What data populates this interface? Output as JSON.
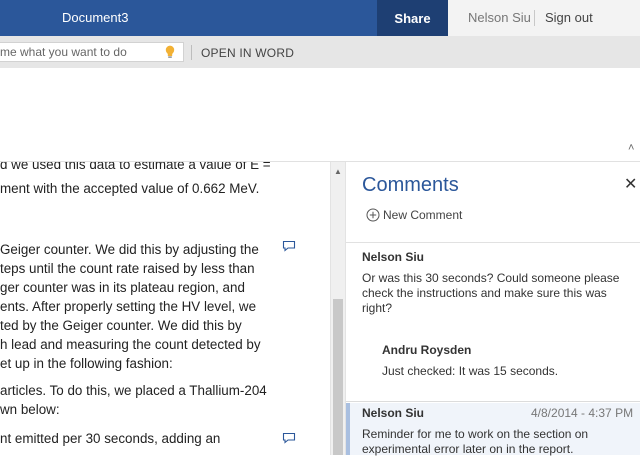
{
  "titlebar": {
    "doc_title": "Document3",
    "share_label": "Share",
    "user_name": "Nelson Siu",
    "sign_out_label": "Sign out"
  },
  "command_bar": {
    "tellme_placeholder": "me what you want to do",
    "tellme_icon": "lightbulb-icon",
    "open_in_word_label": "OPEN IN WORD"
  },
  "document": {
    "lines": [
      "d we used this data to estimate a value of E =",
      "ment with the accepted value of 0.662 MeV.",
      "Geiger counter. We did this by adjusting the",
      "teps until the count rate raised by less than",
      "ger counter was in its plateau region, and",
      "ents. After properly setting the HV level, we",
      "ted by the Geiger counter. We did this by",
      "h lead and measuring the count detected by",
      "et up in the following fashion:",
      "articles. To do this, we placed a Thallium-204",
      "wn below:",
      "nt emitted per 30 seconds, adding an"
    ]
  },
  "comments": {
    "title": "Comments",
    "new_comment_label": "New Comment",
    "threads": [
      {
        "author": "Nelson Siu",
        "text_lines": [
          "Or was this 30 seconds?  Could someone please",
          "check the instructions and make sure this was",
          "right?"
        ],
        "reply": {
          "author": "Andru Roysden",
          "text": "Just checked: It was 15 seconds."
        }
      },
      {
        "author": "Nelson Siu",
        "date": "4/8/2014 - 4:37 PM",
        "text_lines": [
          "Reminder for me to work on the section on",
          "experimental error later on in the report."
        ]
      }
    ]
  },
  "colors": {
    "title_bar": "#2b579a",
    "share_button": "#1e3f73",
    "accent_text": "#2b579a",
    "active_comment_bg": "#f0f4fa"
  }
}
